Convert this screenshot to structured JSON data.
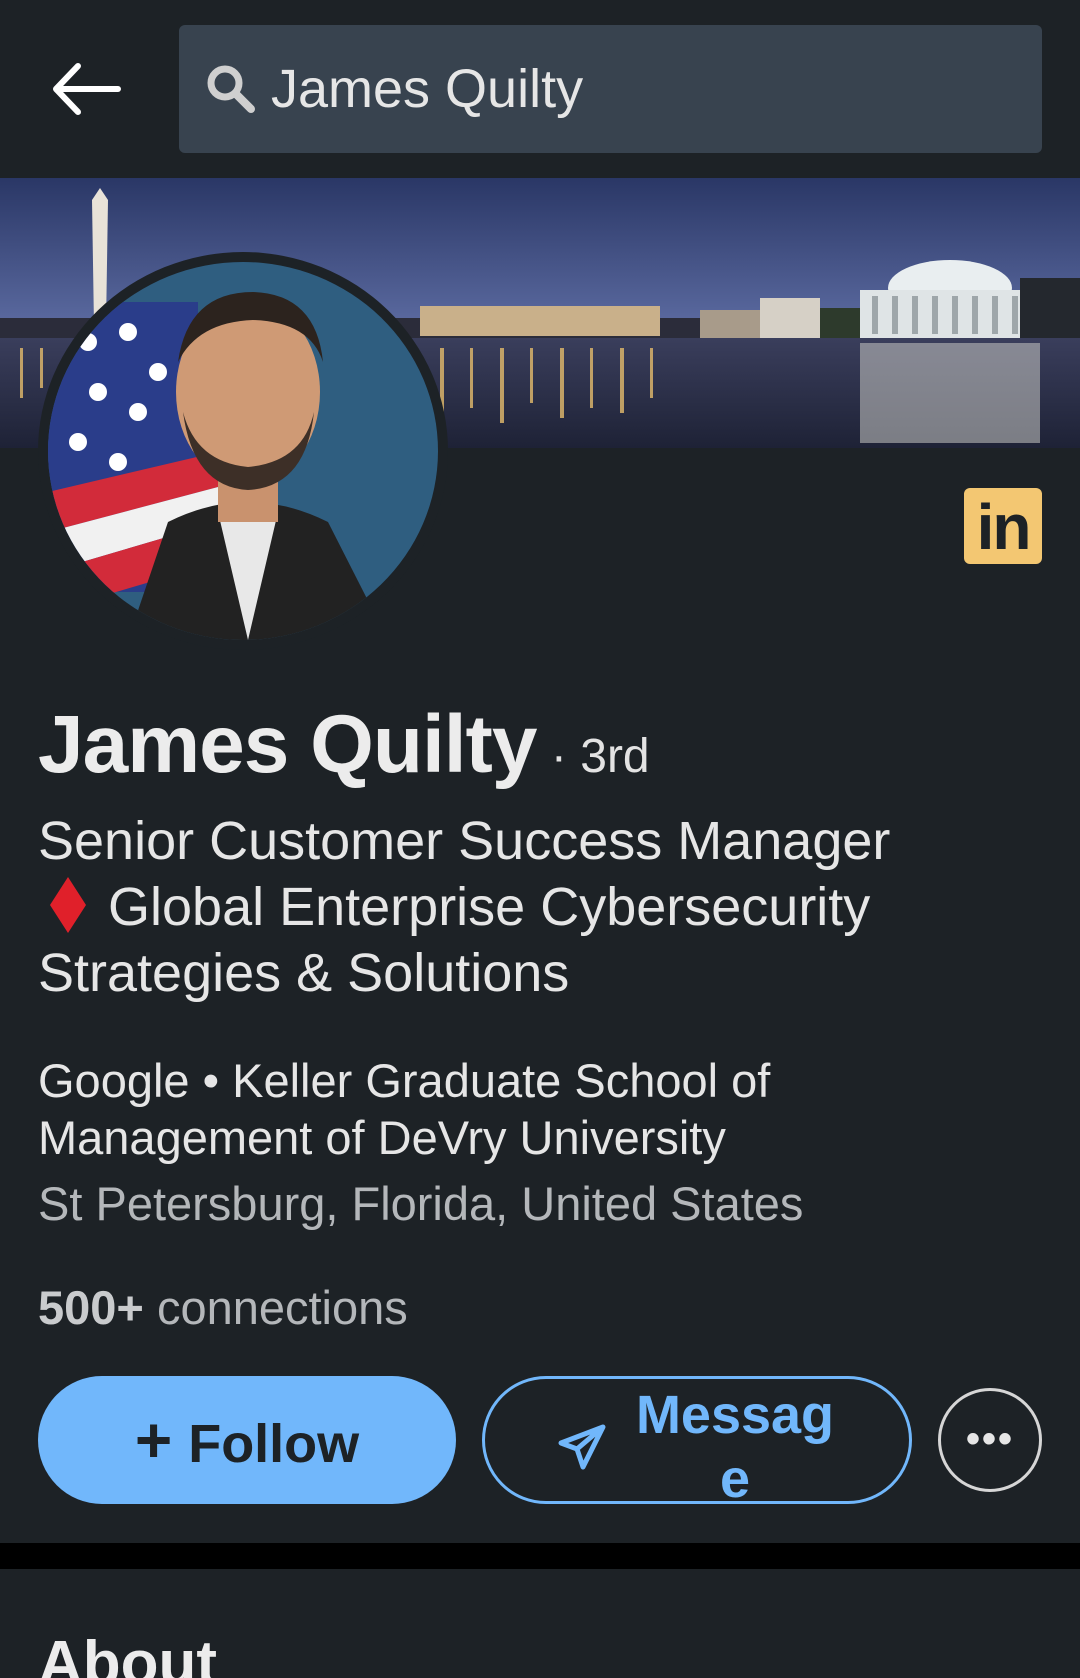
{
  "search": {
    "value": "James Quilty",
    "icon": "search-icon"
  },
  "nav": {
    "back_icon": "arrow-left-icon"
  },
  "profile": {
    "name": "James Quilty",
    "degree": "· 3rd",
    "headline_part1": "Senior Customer Success Manager",
    "headline_part2": "Global Enterprise Cybersecurity Strategies & Solutions",
    "education": "Google • Keller Graduate School of Management of DeVry University",
    "location": "St Petersburg, Florida, United States",
    "connections_count": "500+",
    "connections_label": "connections",
    "badge_text": "in"
  },
  "actions": {
    "follow_plus": "+",
    "follow_label": "Follow",
    "message_label": "Message",
    "more_label": "•••"
  },
  "sections": {
    "about_title": "About"
  },
  "colors": {
    "background": "#1d2226",
    "search_bg": "#38434f",
    "accent_blue": "#71b7fb",
    "badge_gold": "#f3c772",
    "diamond_red": "#e0202a"
  }
}
